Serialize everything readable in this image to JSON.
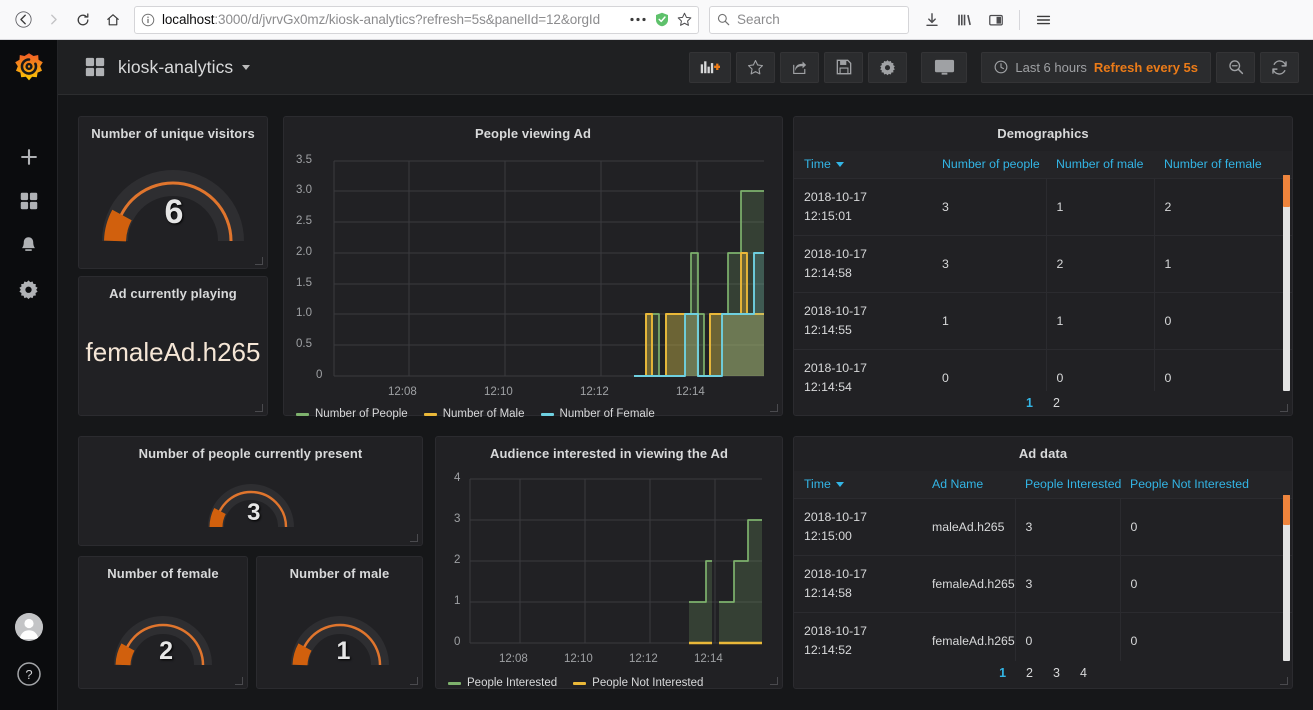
{
  "browser": {
    "url_host": "localhost",
    "url_rest": ":3000/d/jvrvGx0mz/kiosk-analytics?refresh=5s&panelId=12&orgId",
    "search_placeholder": "Search",
    "back_icon": "back-arrow-icon",
    "forward_icon": "forward-arrow-icon",
    "reload_icon": "reload-icon",
    "home_icon": "home-icon",
    "info_icon": "page-info-icon",
    "menu_icon": "page-actions-icon",
    "shield_icon": "tracking-protection-icon",
    "star_icon": "bookmark-icon",
    "downloads_icon": "downloads-icon",
    "library_icon": "library-icon",
    "sidebars_icon": "sidebars-icon",
    "hamburger_icon": "hamburger-menu-icon"
  },
  "sidebar": {
    "logo": "grafana-logo-icon",
    "items": [
      {
        "icon": "plus-icon",
        "name": "create"
      },
      {
        "icon": "dashboards-icon",
        "name": "dashboards"
      },
      {
        "icon": "bell-icon",
        "name": "alerting"
      },
      {
        "icon": "gear-icon",
        "name": "configuration"
      }
    ],
    "avatar": "user-avatar",
    "help": "help-icon"
  },
  "topnav": {
    "dashboard_icon": "dashboard-grid-icon",
    "title": "kiosk-analytics",
    "buttons": [
      {
        "name": "add-panel-button",
        "icon": "add-panel-icon"
      },
      {
        "name": "star-dashboard-button",
        "icon": "star-icon"
      },
      {
        "name": "share-dashboard-button",
        "icon": "share-icon"
      },
      {
        "name": "save-dashboard-button",
        "icon": "save-icon"
      },
      {
        "name": "dashboard-settings-button",
        "icon": "gear-icon"
      },
      {
        "name": "cycle-view-mode-button",
        "icon": "monitor-icon"
      }
    ],
    "time_range": "Last 6 hours",
    "refresh_interval": "Refresh every 5s",
    "clock_icon": "clock-icon",
    "zoom_out_button": "zoom-out-icon",
    "refresh_button": "refresh-icon"
  },
  "colors": {
    "accent_orange": "#eb7b18",
    "gauge_orange": "#e0752d",
    "link_blue": "#33b5e5",
    "series_green": "#7eb26d",
    "series_yellow": "#eab839",
    "series_blue": "#6ed0e0",
    "panel_bg": "#212124",
    "page_bg": "#161719"
  },
  "panels": {
    "unique_visitors": {
      "title": "Number of unique visitors",
      "value": "6",
      "min": 0,
      "max": 100
    },
    "ad_playing": {
      "title": "Ad currently playing",
      "value": "femaleAd.h265"
    },
    "people_present": {
      "title": "Number of people currently present",
      "value": "3",
      "min": 0,
      "max": 100
    },
    "female_count": {
      "title": "Number of female",
      "value": "2",
      "min": 0,
      "max": 100
    },
    "male_count": {
      "title": "Number of male",
      "value": "1",
      "min": 0,
      "max": 100
    }
  },
  "chart_data": [
    {
      "id": "people-viewing-ad",
      "type": "line",
      "title": "People viewing Ad",
      "xlabel": "",
      "ylabel": "",
      "ylim": [
        0,
        3.5
      ],
      "yticks": [
        "0",
        "0.5",
        "1.0",
        "1.5",
        "2.0",
        "2.5",
        "3.0",
        "3.5"
      ],
      "xticks": [
        "12:08",
        "12:10",
        "12:12",
        "12:14"
      ],
      "grid": true,
      "legend_position": "bottom",
      "x": [
        "12:12.6",
        "12:12.8",
        "12:12.9",
        "12:13.0",
        "12:13.1",
        "12:13.3",
        "12:13.5",
        "12:13.6",
        "12:13.7",
        "12:13.8",
        "12:13.9",
        "12:14.0",
        "12:14.2",
        "12:14.4",
        "12:14.6",
        "12:14.8",
        "12:15.0"
      ],
      "series": [
        {
          "name": "Number of People",
          "color": "#7eb26d",
          "values": [
            0,
            1,
            0,
            1,
            1,
            1,
            1,
            2,
            1,
            0,
            1,
            1,
            1,
            1,
            2,
            3,
            3
          ]
        },
        {
          "name": "Number of Male",
          "color": "#eab839",
          "values": [
            0,
            1,
            0,
            1,
            1,
            1,
            1,
            1,
            1,
            0,
            1,
            1,
            1,
            1,
            1,
            2,
            1
          ]
        },
        {
          "name": "Number of Female",
          "color": "#6ed0e0",
          "values": [
            0,
            0,
            0,
            0,
            0,
            0,
            1,
            1,
            0,
            0,
            0,
            0,
            1,
            1,
            1,
            1,
            2
          ]
        }
      ]
    },
    {
      "id": "audience-interested",
      "type": "area",
      "title": "Audience interested in viewing the Ad",
      "xlabel": "",
      "ylabel": "",
      "ylim": [
        0,
        4
      ],
      "yticks": [
        "0",
        "1",
        "2",
        "3",
        "4"
      ],
      "xticks": [
        "12:08",
        "12:10",
        "12:12",
        "12:14"
      ],
      "grid": true,
      "legend_position": "bottom",
      "x": [
        "12:13.4",
        "12:13.6",
        "12:13.8",
        "12:13.9",
        "12:14.1",
        "12:14.3",
        "12:14.5",
        "12:14.7",
        "12:14.9",
        "12:15.0"
      ],
      "series": [
        {
          "name": "People Interested",
          "color": "#7eb26d",
          "values": [
            1,
            1,
            2,
            0,
            1,
            1,
            2,
            2,
            3,
            3
          ]
        },
        {
          "name": "People Not Interested",
          "color": "#eab839",
          "values": [
            0,
            0,
            0,
            0,
            0,
            0,
            0,
            0,
            0,
            0
          ]
        }
      ]
    }
  ],
  "demographics_table": {
    "title": "Demographics",
    "columns": [
      "Time",
      "Number of people",
      "Number of male",
      "Number of female"
    ],
    "sorted_column": "Time",
    "rows": [
      {
        "time": "2018-10-17\n12:15:01",
        "people": "3",
        "male": "1",
        "female": "2"
      },
      {
        "time": "2018-10-17\n12:14:58",
        "people": "3",
        "male": "2",
        "female": "1"
      },
      {
        "time": "2018-10-17\n12:14:55",
        "people": "1",
        "male": "1",
        "female": "0"
      },
      {
        "time": "2018-10-17\n12:14:54",
        "people": "0",
        "male": "0",
        "female": "0"
      }
    ],
    "pages": [
      "1",
      "2"
    ],
    "active_page": "1"
  },
  "ad_data_table": {
    "title": "Ad data",
    "columns": [
      "Time",
      "Ad Name",
      "People Interested",
      "People Not Interested"
    ],
    "sorted_column": "Time",
    "rows": [
      {
        "time": "2018-10-17\n12:15:00",
        "ad": "maleAd.h265",
        "interested": "3",
        "not_interested": "0"
      },
      {
        "time": "2018-10-17\n12:14:58",
        "ad": "femaleAd.h265",
        "interested": "3",
        "not_interested": "0"
      },
      {
        "time": "2018-10-17\n12:14:52",
        "ad": "femaleAd.h265",
        "interested": "0",
        "not_interested": "0"
      }
    ],
    "pages": [
      "1",
      "2",
      "3",
      "4"
    ],
    "active_page": "1"
  }
}
